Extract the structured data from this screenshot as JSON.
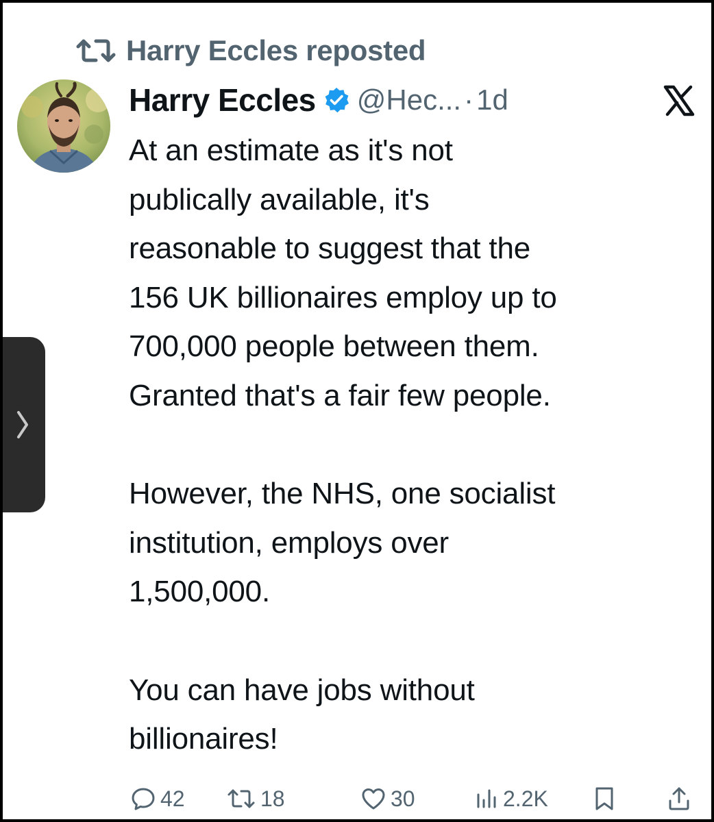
{
  "repost": {
    "text": "Harry Eccles reposted",
    "icon": "repost-icon"
  },
  "author": {
    "name": "Harry Eccles",
    "handle": "@Hec...",
    "separator": "·",
    "time": "1d",
    "verified_color": "#1d9bf0"
  },
  "platform_icon": "x-logo-icon",
  "tweet": {
    "paragraphs": [
      "At an estimate as it's not publically available, it's reasonable to suggest that the 156 UK billionaires employ up to 700,000 people between them. Granted that's a fair few people.",
      "However, the NHS, one socialist institution, employs over 1,500,000.",
      "You can have jobs without billionaires!"
    ],
    "lines": [
      "At an estimate as it's not",
      "publically available, it's",
      "reasonable to suggest that the",
      "156 UK billionaires employ up to",
      "700,000 people between them.",
      "Granted that's a fair few people.",
      "However, the NHS, one socialist",
      "institution, employs over",
      "1,500,000.",
      "You can have jobs without",
      "billionaires!"
    ]
  },
  "actions": {
    "replies": "42",
    "reposts": "18",
    "likes": "30",
    "views": "2.2K"
  },
  "colors": {
    "text": "#0f1419",
    "secondary": "#536471",
    "accent": "#1d9bf0"
  }
}
